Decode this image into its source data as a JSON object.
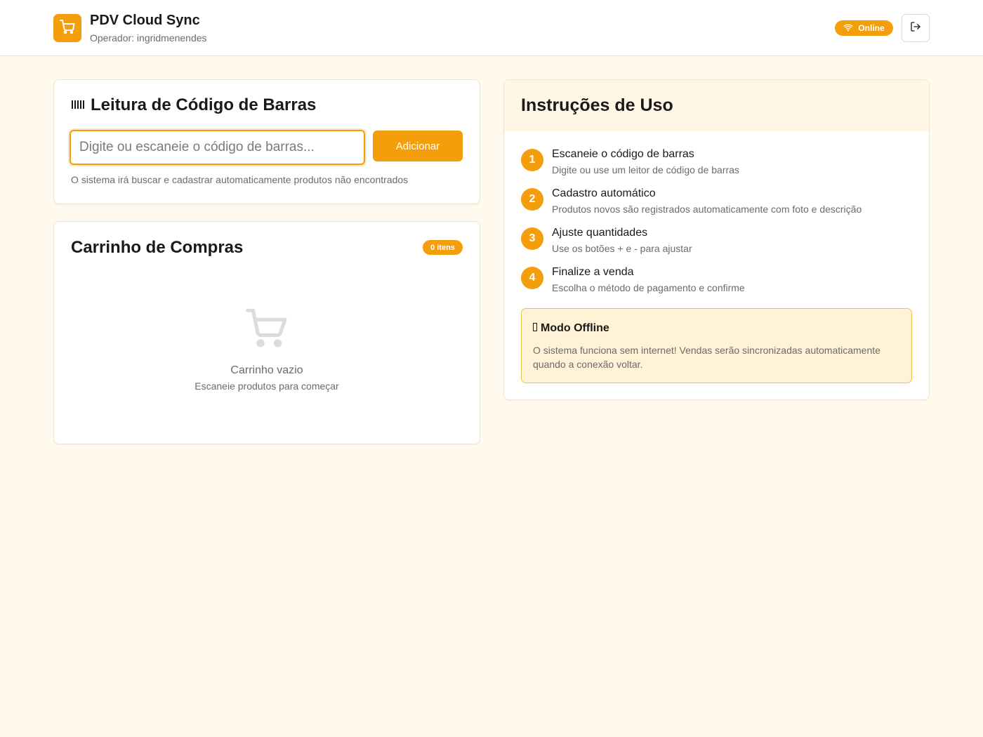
{
  "header": {
    "app_title": "PDV Cloud Sync",
    "operator": "Operador: ingridmenendes",
    "status": "Online",
    "logo_icon": "shopping-cart-icon",
    "status_icon": "wifi-icon",
    "logout_icon": "logout-icon"
  },
  "barcode": {
    "title": "Leitura de Código de Barras",
    "title_icon": "barcode-icon",
    "input_placeholder": "Digite ou escaneie o código de barras...",
    "input_value": "",
    "add_label": "Adicionar",
    "hint": "O sistema irá buscar e cadastrar automaticamente produtos não encontrados"
  },
  "cart": {
    "title": "Carrinho de Compras",
    "count_badge": "0 itens",
    "empty_title": "Carrinho vazio",
    "empty_subtitle": "Escaneie produtos para começar",
    "empty_icon": "shopping-cart-icon"
  },
  "instructions": {
    "title": "Instruções de Uso",
    "steps": [
      {
        "number": "1",
        "title": "Escaneie o código de barras",
        "description": "Digite ou use um leitor de código de barras"
      },
      {
        "number": "2",
        "title": "Cadastro automático",
        "description": "Produtos novos são registrados automaticamente com foto e descrição"
      },
      {
        "number": "3",
        "title": "Ajuste quantidades",
        "description": "Use os botões + e - para ajustar"
      },
      {
        "number": "4",
        "title": "Finalize a venda",
        "description": "Escolha o método de pagamento e confirme"
      }
    ],
    "offline": {
      "icon": "missing-glyph-icon",
      "title": "Modo Offline",
      "text": "O sistema funciona sem internet! Vendas serão sincronizadas automaticamente quando a conexão voltar."
    }
  },
  "colors": {
    "accent": "#f59e0b",
    "background": "#fffaed",
    "offline_box": "#fff2d6"
  }
}
